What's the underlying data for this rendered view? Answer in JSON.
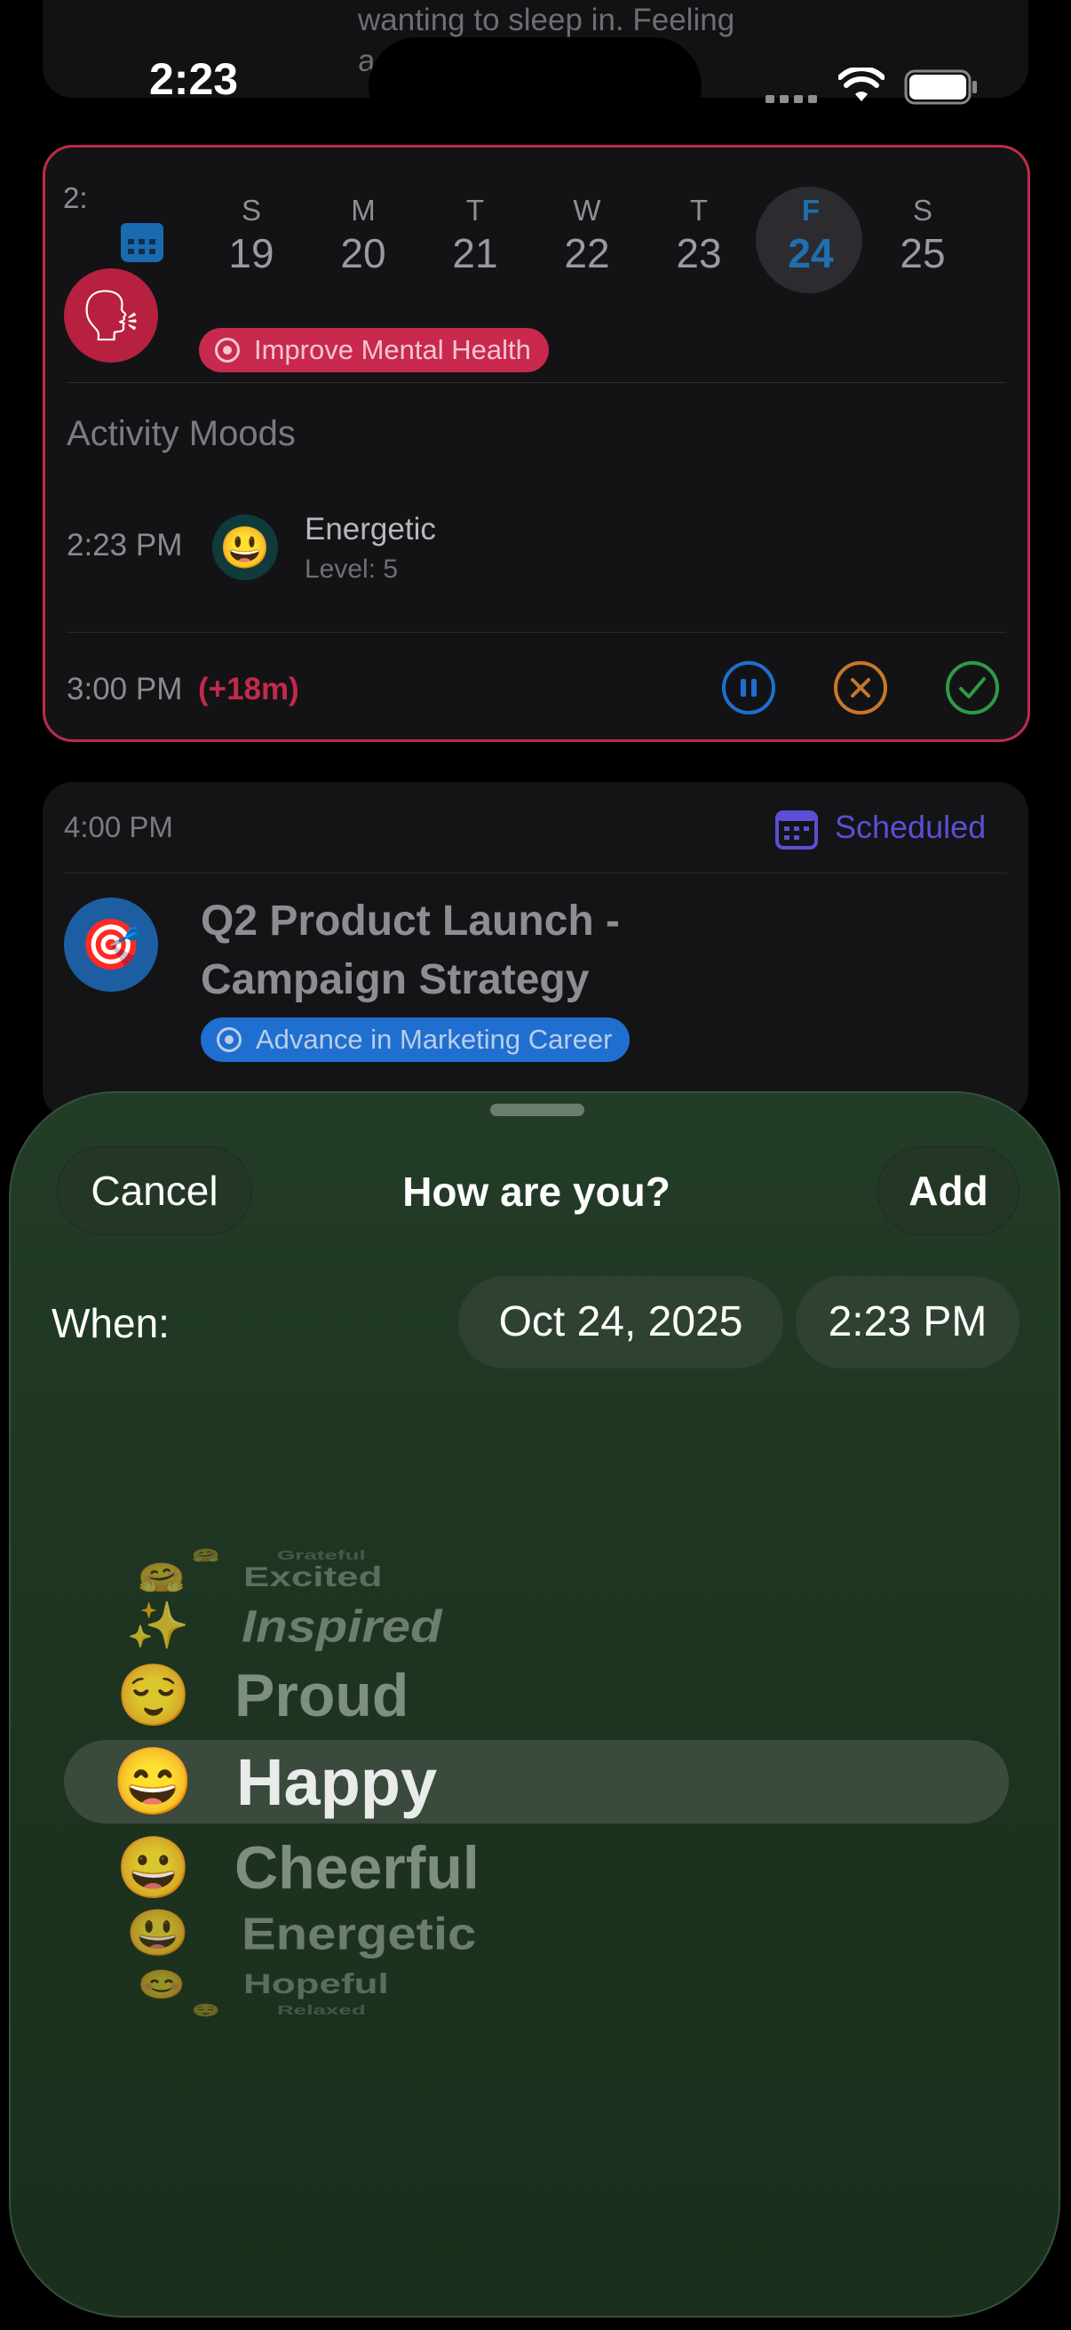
{
  "status_bar": {
    "time": "2:23"
  },
  "top_card": {
    "note_line1": "wanting to sleep in. Feeling",
    "note_line2": "a"
  },
  "week": {
    "days": [
      {
        "letter": "S",
        "num": "19"
      },
      {
        "letter": "M",
        "num": "20"
      },
      {
        "letter": "T",
        "num": "21"
      },
      {
        "letter": "W",
        "num": "22"
      },
      {
        "letter": "T",
        "num": "23"
      },
      {
        "letter": "F",
        "num": "24",
        "selected": true
      },
      {
        "letter": "S",
        "num": "25"
      }
    ]
  },
  "active_card": {
    "goal": "Improve Mental Health",
    "moods_heading": "Activity Moods",
    "mood_time": "2:23 PM",
    "mood_emoji": "😃",
    "mood_name": "Energetic",
    "mood_level": "Level: 5",
    "end_time": "3:00 PM",
    "overtime": "(+18m)",
    "colors": {
      "border": "#c12a4b",
      "goal_pill": "#c8294d",
      "pause": "#1f6fd0",
      "cancel": "#c7772a",
      "done": "#2f9a45"
    }
  },
  "scheduled_card": {
    "time": "4:00 PM",
    "status": "Scheduled",
    "title_line1": "Q2 Product Launch -",
    "title_line2": "Campaign Strategy",
    "goal": "Advance in Marketing Career",
    "colors": {
      "status": "#5a4fd6",
      "goal_pill": "#1f6fd0"
    }
  },
  "sheet": {
    "cancel_label": "Cancel",
    "title": "How are you?",
    "add_label": "Add",
    "when_label": "When:",
    "date_value": "Oct 24, 2025",
    "time_value": "2:23 PM"
  },
  "picker": {
    "options": [
      {
        "emoji": "🤗",
        "label": "Grateful"
      },
      {
        "emoji": "🤗",
        "label": "Excited"
      },
      {
        "emoji": "✨",
        "label": "Inspired"
      },
      {
        "emoji": "😌",
        "label": "Proud"
      },
      {
        "emoji": "😄",
        "label": "Happy",
        "selected": true
      },
      {
        "emoji": "😀",
        "label": "Cheerful"
      },
      {
        "emoji": "😃",
        "label": "Energetic"
      },
      {
        "emoji": "😊",
        "label": "Hopeful"
      },
      {
        "emoji": "😌",
        "label": "Relaxed"
      }
    ]
  }
}
